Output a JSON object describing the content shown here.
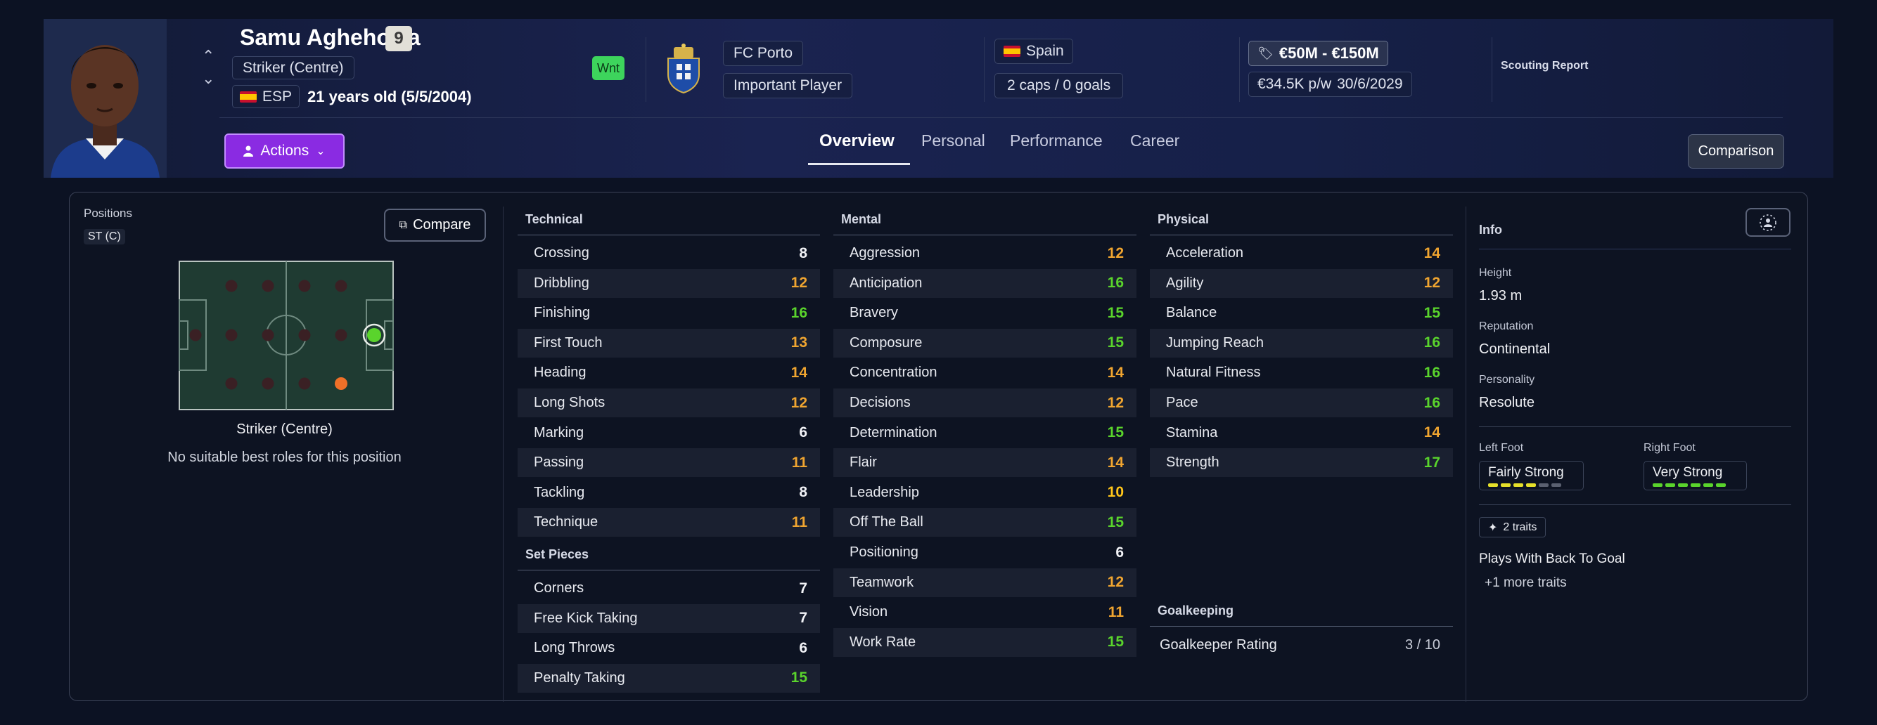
{
  "player": {
    "name": "Samu Aghehowa",
    "number": "9",
    "position": "Striker (Centre)",
    "nationality_code": "ESP",
    "age_text": "21 years old (5/5/2004)",
    "status_badge": "Wnt",
    "club": "FC Porto",
    "squad_status": "Important Player",
    "nation": "Spain",
    "caps": "2 caps / 0 goals",
    "value": "€50M - €150M",
    "wage": "€34.5K p/w",
    "contract_end": "30/6/2029",
    "scouting_report": "Scouting Report"
  },
  "actions_label": "Actions",
  "tabs": [
    {
      "label": "Overview",
      "active": true
    },
    {
      "label": "Personal",
      "active": false
    },
    {
      "label": "Performance",
      "active": false
    },
    {
      "label": "Career",
      "active": false
    }
  ],
  "comparison_label": "Comparison",
  "positions": {
    "title": "Positions",
    "tag": "ST (C)",
    "compare_label": "Compare",
    "selected_name": "Striker (Centre)",
    "roles_note": "No suitable best roles for this position"
  },
  "technical": {
    "title": "Technical",
    "attributes": [
      {
        "name": "Crossing",
        "value": "8",
        "color": "#f2f3f7"
      },
      {
        "name": "Dribbling",
        "value": "12",
        "color": "#f0a530"
      },
      {
        "name": "Finishing",
        "value": "16",
        "color": "#5ad42c"
      },
      {
        "name": "First Touch",
        "value": "13",
        "color": "#f0a530"
      },
      {
        "name": "Heading",
        "value": "14",
        "color": "#f0a530"
      },
      {
        "name": "Long Shots",
        "value": "12",
        "color": "#f0a530"
      },
      {
        "name": "Marking",
        "value": "6",
        "color": "#f2f3f7"
      },
      {
        "name": "Passing",
        "value": "11",
        "color": "#f0a530"
      },
      {
        "name": "Tackling",
        "value": "8",
        "color": "#f2f3f7"
      },
      {
        "name": "Technique",
        "value": "11",
        "color": "#f0a530"
      }
    ]
  },
  "set_pieces": {
    "title": "Set Pieces",
    "attributes": [
      {
        "name": "Corners",
        "value": "7",
        "color": "#f2f3f7"
      },
      {
        "name": "Free Kick Taking",
        "value": "7",
        "color": "#f2f3f7"
      },
      {
        "name": "Long Throws",
        "value": "6",
        "color": "#f2f3f7"
      },
      {
        "name": "Penalty Taking",
        "value": "15",
        "color": "#5ad42c"
      }
    ]
  },
  "mental": {
    "title": "Mental",
    "attributes": [
      {
        "name": "Aggression",
        "value": "12",
        "color": "#f0a530"
      },
      {
        "name": "Anticipation",
        "value": "16",
        "color": "#5ad42c"
      },
      {
        "name": "Bravery",
        "value": "15",
        "color": "#5ad42c"
      },
      {
        "name": "Composure",
        "value": "15",
        "color": "#5ad42c"
      },
      {
        "name": "Concentration",
        "value": "14",
        "color": "#f0a530"
      },
      {
        "name": "Decisions",
        "value": "12",
        "color": "#f0a530"
      },
      {
        "name": "Determination",
        "value": "15",
        "color": "#5ad42c"
      },
      {
        "name": "Flair",
        "value": "14",
        "color": "#f0a530"
      },
      {
        "name": "Leadership",
        "value": "10",
        "color": "#ffc51a"
      },
      {
        "name": "Off The Ball",
        "value": "15",
        "color": "#5ad42c"
      },
      {
        "name": "Positioning",
        "value": "6",
        "color": "#f2f3f7"
      },
      {
        "name": "Teamwork",
        "value": "12",
        "color": "#f0a530"
      },
      {
        "name": "Vision",
        "value": "11",
        "color": "#f0a530"
      },
      {
        "name": "Work Rate",
        "value": "15",
        "color": "#5ad42c"
      }
    ]
  },
  "physical": {
    "title": "Physical",
    "attributes": [
      {
        "name": "Acceleration",
        "value": "14",
        "color": "#f0a530"
      },
      {
        "name": "Agility",
        "value": "12",
        "color": "#f0a530"
      },
      {
        "name": "Balance",
        "value": "15",
        "color": "#5ad42c"
      },
      {
        "name": "Jumping Reach",
        "value": "16",
        "color": "#5ad42c"
      },
      {
        "name": "Natural Fitness",
        "value": "16",
        "color": "#5ad42c"
      },
      {
        "name": "Pace",
        "value": "16",
        "color": "#5ad42c"
      },
      {
        "name": "Stamina",
        "value": "14",
        "color": "#f0a530"
      },
      {
        "name": "Strength",
        "value": "17",
        "color": "#5ad42c"
      }
    ]
  },
  "goalkeeping": {
    "title": "Goalkeeping",
    "rating_label": "Goalkeeper Rating",
    "rating_value": "3 / 10"
  },
  "info": {
    "title": "Info",
    "height_label": "Height",
    "height": "1.93 m",
    "reputation_label": "Reputation",
    "reputation": "Continental",
    "personality_label": "Personality",
    "personality": "Resolute",
    "left_foot_label": "Left Foot",
    "left_foot": "Fairly Strong",
    "left_foot_level": 4,
    "right_foot_label": "Right Foot",
    "right_foot": "Very Strong",
    "right_foot_level": 6,
    "traits_badge": "2 traits",
    "trait_1": "Plays With Back To Goal",
    "more_traits": "+1 more traits"
  },
  "colors": {
    "accent": "#8a2be2",
    "good": "#5ad42c",
    "average": "#f0a530",
    "wanted": "#3dd45c"
  }
}
